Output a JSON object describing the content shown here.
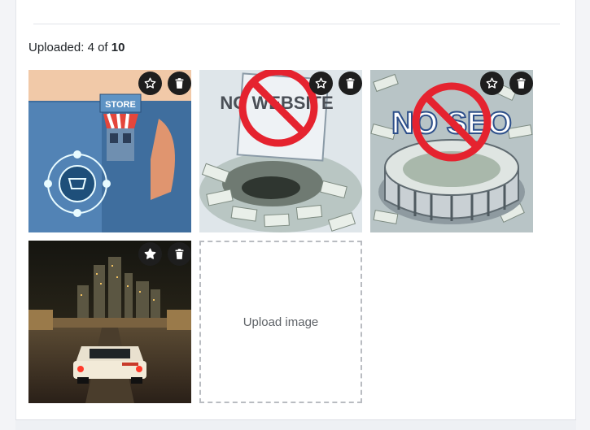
{
  "uploader": {
    "count_prefix": "Uploaded: ",
    "count_current": "4",
    "count_separator": " of ",
    "count_max": "10",
    "upload_label": "Upload image"
  },
  "images": [
    {
      "name": "store-jeans-pocket-image",
      "featured": false,
      "text_on_image": "STORE"
    },
    {
      "name": "no-website-money-pit-image",
      "featured": false,
      "text_on_image": "NO WEBSITE"
    },
    {
      "name": "no-seo-money-pit-image",
      "featured": false,
      "text_on_image": "NO SEO"
    },
    {
      "name": "night-city-car-image",
      "featured": true,
      "text_on_image": ""
    }
  ],
  "icons": {
    "favorite": "star-icon",
    "delete": "trash-icon",
    "button_bg": "#1e1e1e"
  }
}
